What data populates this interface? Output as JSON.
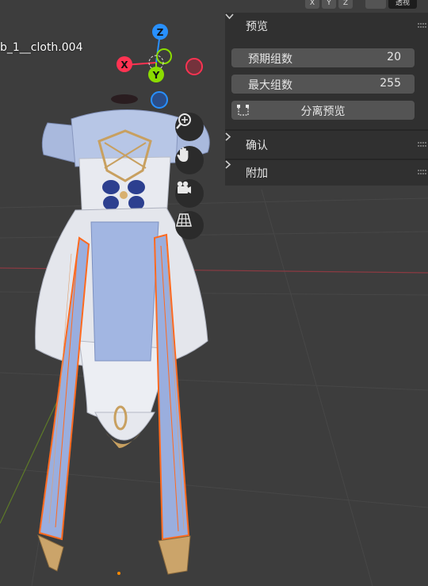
{
  "viewport": {
    "object_name": "b_1__cloth.004",
    "header_buttons": [
      "",
      "X",
      "Y",
      "Z",
      "",
      "",
      "透视"
    ],
    "gizmo_axes": {
      "x": "X",
      "y": "Y",
      "z": "Z"
    },
    "nav_icons": [
      "zoom-icon",
      "hand-pan-icon",
      "camera-icon",
      "perspective-grid-icon"
    ],
    "colors": {
      "background": "#3d3d3d",
      "x_axis": "#ff3352",
      "y_axis": "#8bdc00",
      "z_axis": "#2890ff",
      "selection_outline": "#ff6a1f"
    }
  },
  "panel": {
    "sections": [
      {
        "title": "预览",
        "expanded": true,
        "fields": [
          {
            "label": "预期组数",
            "value": "20"
          },
          {
            "label": "最大组数",
            "value": "255"
          }
        ],
        "button": {
          "label": "分离预览",
          "icon": "separate-preview-icon"
        }
      },
      {
        "title": "确认",
        "expanded": false
      },
      {
        "title": "附加",
        "expanded": false
      }
    ]
  }
}
